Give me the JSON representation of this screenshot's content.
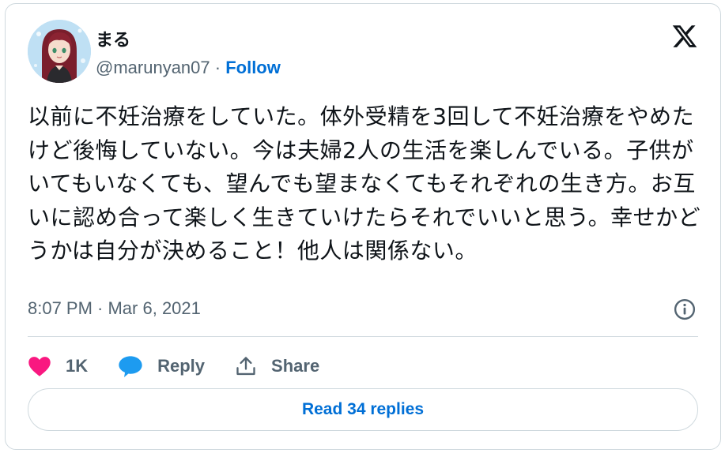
{
  "author": {
    "display_name": "まる",
    "handle": "@marunyan07",
    "separator": " · ",
    "follow_label": "Follow"
  },
  "tweet": {
    "text": "以前に不妊治療をしていた。体外受精を3回して不妊治療をやめたけど後悔していない。今は夫婦2人の生活を楽しんでいる。子供がいてもいなくても、望んでも望まなくてもそれぞれの生き方。お互いに認め合って楽しく生きていけたらそれでいいと思う。幸せかどうかは自分が決めること！他人は関係ない。",
    "timestamp": "8:07 PM · Mar 6, 2021"
  },
  "actions": {
    "like_count": "1K",
    "reply_label": "Reply",
    "share_label": "Share"
  },
  "footer": {
    "read_replies_label": "Read 34 replies"
  },
  "icons": {
    "brand": "x-logo-icon",
    "info": "info-icon",
    "like": "heart-icon",
    "reply": "speech-bubble-icon",
    "share": "share-upload-icon"
  },
  "colors": {
    "link": "#006fd6",
    "heart": "#f91880",
    "reply_bubble": "#1d9bf0",
    "muted_text": "#536471",
    "border": "#cfd9de"
  }
}
